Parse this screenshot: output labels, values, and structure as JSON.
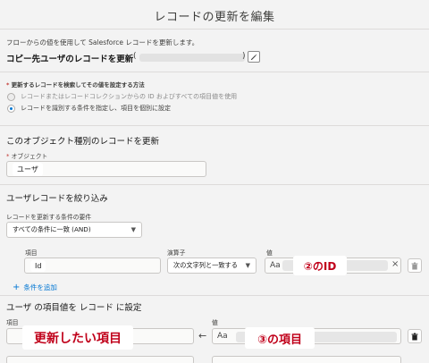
{
  "header": {
    "title": "レコードの更新を編集"
  },
  "description": "フローからの値を使用して Salesforce レコードを更新します。",
  "action": {
    "title": "コピー先ユーザのレコードを更新",
    "id_open": "(",
    "id_close": ")"
  },
  "find_method": {
    "label": "更新するレコードを検索してその値を設定する方法",
    "required_mark": "*",
    "options": [
      {
        "label": "レコードまたはレコードコレクションからの ID およびすべての項目値を使用",
        "checked": false
      },
      {
        "label": "レコードを識別する条件を指定し、項目を個別に設定",
        "checked": true
      }
    ]
  },
  "object_section": {
    "title": "このオブジェクト種別のレコードを更新",
    "object_label": "オブジェクト",
    "required_mark": "*",
    "object_value": "ユーザ"
  },
  "filter_section": {
    "title": "ユーザレコードを絞り込み",
    "condition_label": "レコードを更新する条件の要件",
    "condition_value": "すべての条件に一致 (AND)",
    "columns": {
      "field": "項目",
      "operator": "演算子",
      "value": "値"
    },
    "row": {
      "field": "Id",
      "operator": "次の文字列と一致する",
      "value_annotation": "②のID"
    },
    "add_condition": "条件を追加"
  },
  "set_section": {
    "title": "ユーザ の項目値を レコード に設定",
    "columns": {
      "field": "項目",
      "value": "値"
    },
    "row": {
      "field_annotation": "更新したい項目",
      "arrow": "←",
      "value_annotation": "③の項目"
    }
  },
  "icons": {
    "edit": "pencil-icon",
    "data_type": "Aa",
    "clear": "×",
    "delete": "trash-icon",
    "add": "+"
  },
  "colors": {
    "annotation_text": "#c0001a",
    "link": "#0176d3",
    "required": "#c23934"
  }
}
